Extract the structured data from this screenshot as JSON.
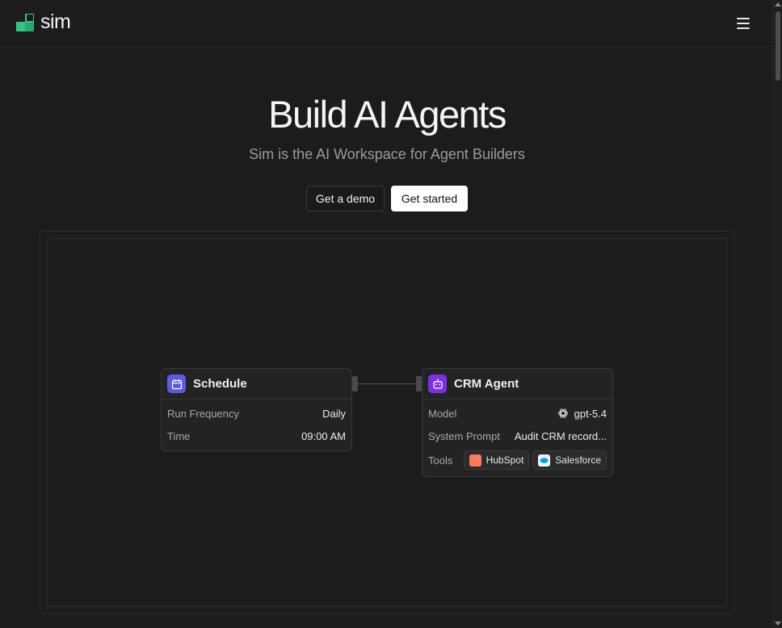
{
  "header": {
    "logo_text": "sim",
    "logo_icon": "sim-logo-icon",
    "menu_icon": "hamburger-menu-icon"
  },
  "hero": {
    "title": "Build AI Agents",
    "subtitle": "Sim is the AI Workspace for Agent Builders",
    "demo_button": "Get a demo",
    "start_button": "Get started"
  },
  "workflow": {
    "schedule": {
      "title": "Schedule",
      "icon": "calendar-icon",
      "icon_color": "#5b5be6",
      "rows": [
        {
          "label": "Run Frequency",
          "value": "Daily"
        },
        {
          "label": "Time",
          "value": "09:00 AM"
        }
      ]
    },
    "agent": {
      "title": "CRM Agent",
      "icon": "robot-icon",
      "icon_color": "#7d2fe8",
      "model_label": "Model",
      "model_value": "gpt-5.4",
      "model_icon": "openai-icon",
      "prompt_label": "System Prompt",
      "prompt_value": "Audit CRM record...",
      "tools_label": "Tools",
      "tools": [
        {
          "name": "HubSpot",
          "icon": "hubspot-icon",
          "color": "#ff7a59"
        },
        {
          "name": "Salesforce",
          "icon": "salesforce-icon",
          "color": "#00a1e0"
        }
      ]
    }
  },
  "colors": {
    "background": "#1c1c1c",
    "brand_green": "#33c482"
  }
}
